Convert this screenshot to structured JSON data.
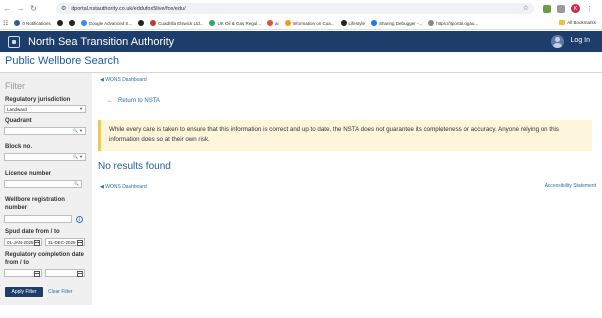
{
  "browser": {
    "url": "itportal.nstauthority.co.uk/eddufox5live/fox/edu/",
    "bookmarks": [
      {
        "label": "0 Notifications",
        "color": "#3b5998"
      },
      {
        "label": "",
        "color": "#222222"
      },
      {
        "label": "",
        "color": "#222222"
      },
      {
        "label": "Google Advanced S...",
        "color": "#4285f4"
      },
      {
        "label": "",
        "color": "#222222"
      },
      {
        "label": "Cuadrilla Elswick Ltd...",
        "color": "#c0392b"
      },
      {
        "label": "UK Oil & Gas Regul...",
        "color": "#27ae60"
      },
      {
        "label": "ai",
        "color": "#e74c3c"
      },
      {
        "label": "Information on Cua...",
        "color": "#f39c12"
      },
      {
        "label": "Lifestyle",
        "color": "#222222"
      },
      {
        "label": "Sharing Debugger -...",
        "color": "#1877f2"
      },
      {
        "label": "https://itportal.ogau...",
        "color": "#888888"
      }
    ],
    "all_bookmarks": "All Bookmarks",
    "profile_initial": "K"
  },
  "header": {
    "org": "North Sea Transition Authority",
    "login": "Log In"
  },
  "app_title": "Public Wellbore Search",
  "filter": {
    "heading": "Filter",
    "jurisdiction_label": "Regulatory jurisdiction",
    "jurisdiction_value": "Landward",
    "quadrant_label": "Quadrant",
    "block_label": "Block no.",
    "licence_label": "Licence number",
    "wellbore_label": "Wellbore registration number",
    "spud_label": "Spud date from / to",
    "spud_from": "01-JAN-2025",
    "spud_to": "31-DEC-2025",
    "completion_label": "Regulatory completion date from / to",
    "apply": "Apply Filter",
    "clear": "Clear Filter"
  },
  "main": {
    "dashboard_link": "WONS Dashboard",
    "back_link": "Return to NSTA",
    "warning": "While every care is taken to ensure that this information is correct and up to date, the NSTA does not guarantee its completeness or accuracy. Anyone relying on this information does so at their own risk.",
    "no_results": "No results found",
    "dashboard_link_bottom": "WONS Dashboard",
    "accessibility": "Accessibility Statement"
  }
}
